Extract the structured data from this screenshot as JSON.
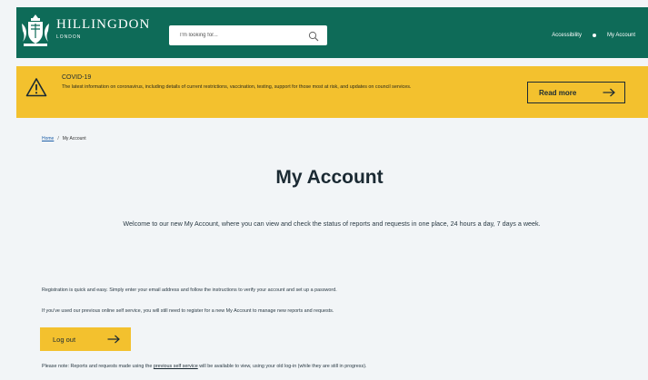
{
  "header": {
    "brand_name": "HILLINGDON",
    "brand_sub": "LONDON",
    "search_placeholder": "I'm looking for...",
    "nav": [
      {
        "label": "Accessibility"
      },
      {
        "label": "My Account"
      }
    ]
  },
  "banner": {
    "title": "COVID-19",
    "text": "The latest information on coronavirus, including details of current restrictions, vaccination, testing, support for those most at risk, and updates on council services.",
    "read_more_label": "Read more"
  },
  "breadcrumb": {
    "home": "Home",
    "separator": "/",
    "current": "My Account"
  },
  "main": {
    "title": "My Account",
    "welcome": "Welcome to our new My Account, where you can view and check the status of reports and requests in one place, 24 hours a day, 7 days a week.",
    "registration_text": "Registration is quick and easy. Simply enter your email address and follow the instructions to verify your account and set up a password.",
    "previous_service_text": "If you've used our previous online self service, you will still need to register for a new My Account to manage new reports and requests.",
    "logout_label": "Log out",
    "note_prefix": "Please note: Reports and requests made using the ",
    "note_link": "previous self service",
    "note_suffix": " will be available to view, using your old log-in (while they are still in progress)."
  },
  "colors": {
    "header_bg": "#0e6b58",
    "banner_bg": "#f3c12e",
    "page_bg": "#f2f5f7",
    "text": "#1b2a33",
    "link": "#1e5fa8"
  },
  "icons": [
    "crest-logo-icon",
    "search-icon",
    "warning-icon",
    "arrow-right-icon"
  ]
}
